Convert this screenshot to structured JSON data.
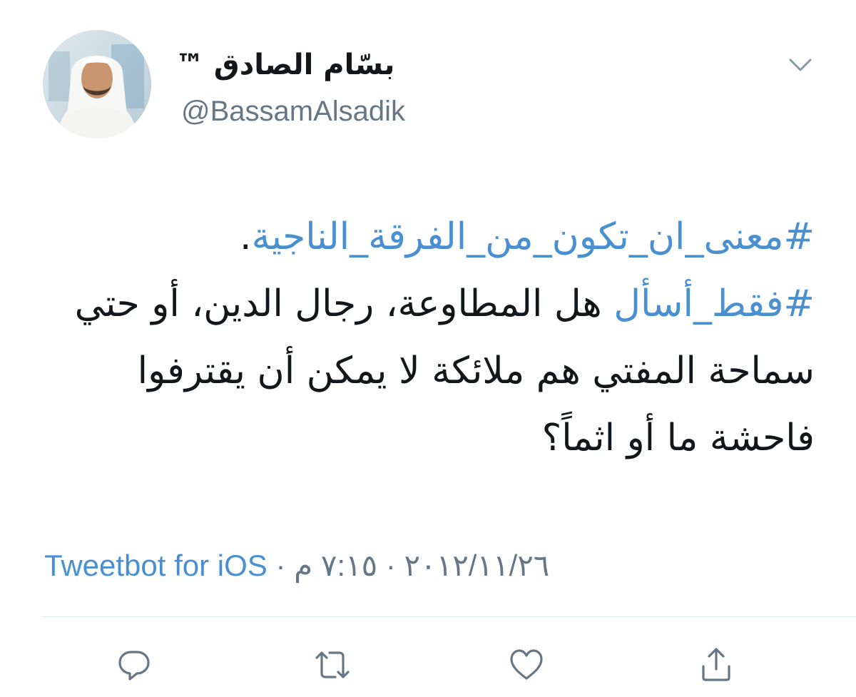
{
  "author": {
    "display_name": "بسّام الصادق ™",
    "handle": "@BassamAlsadik",
    "avatar_icon": "profile-photo"
  },
  "tweet": {
    "line1_hashtag": "#معنى_ان_تكون_من_الفرقة_الناجية",
    "line1_suffix": ".",
    "line2_hashtag": "#فقط_أسأل",
    "line2_text": " هل المطاوعة، رجال الدين، أو حتي سماحة المفتي هم ملائكة لا يمكن أن يقترفوا فاحشة ما أو اثماً؟"
  },
  "meta": {
    "time": "٧:١٥ م",
    "separator": "·",
    "date": "٢٠١٢/١١/٢٦",
    "source": "Tweetbot for iOS"
  },
  "actions": {
    "reply_icon": "reply-icon",
    "retweet_icon": "retweet-icon",
    "like_icon": "heart-icon",
    "share_icon": "share-icon"
  },
  "colors": {
    "link": "#4a90d1",
    "secondary": "#657786",
    "text": "#14171a",
    "icon": "#657786"
  }
}
